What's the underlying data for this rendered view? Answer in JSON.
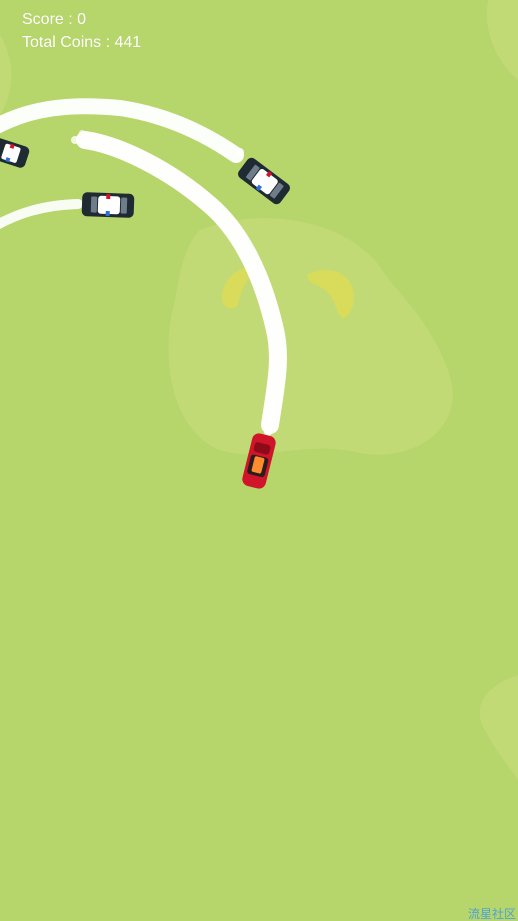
{
  "hud": {
    "score_label": "Score",
    "score_value": "0",
    "coins_label": "Total Coins",
    "coins_value": "441"
  },
  "watermark": "流星社区",
  "colors": {
    "grass": "#b6d56a",
    "grass_patch": "#c1da75",
    "mound_yellow": "#d8dc5a",
    "smoke": "#ffffff",
    "player_car": "#d0142a",
    "police_car_body": "#1f2a33",
    "police_car_roof": "#ffffff"
  },
  "entities": {
    "player": "red-car",
    "enemies": [
      "police-car",
      "police-car",
      "police-car"
    ]
  }
}
